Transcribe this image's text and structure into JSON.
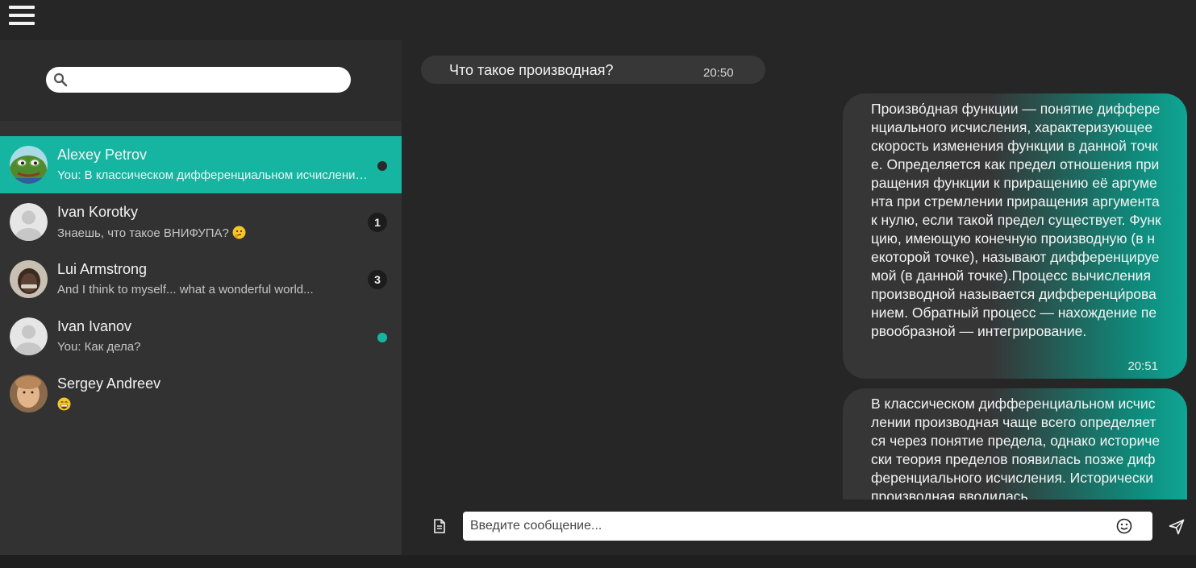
{
  "header": {
    "menu_icon": "hamburger-menu-icon"
  },
  "search": {
    "placeholder": "",
    "value": "",
    "icon": "search-icon"
  },
  "chats": [
    {
      "name": "Alexey Petrov",
      "preview": "You: В классическом дифференциальном исчислении производная чаще всего определяется",
      "indicator": "dot-dark",
      "active": true,
      "avatar": "frog-avatar"
    },
    {
      "name": "Ivan Korotky",
      "preview": "Знаешь, что такое ВНИФУПА?",
      "preview_emoji": "thinking-face-emoji",
      "badge": "1",
      "avatar": "default-user-avatar"
    },
    {
      "name": "Lui Armstrong",
      "preview": "And I think to myself... what a wonderful world...",
      "badge": "3",
      "avatar": "photo-avatar"
    },
    {
      "name": "Ivan Ivanov",
      "preview": "You: Как дела?",
      "indicator": "dot-teal",
      "avatar": "default-user-avatar"
    },
    {
      "name": "Sergey Andreev",
      "preview": "",
      "preview_emoji": "grinning-face-emoji",
      "avatar": "photo-avatar"
    }
  ],
  "messages": [
    {
      "direction": "in",
      "text": "Что такое производная?",
      "time": "20:50"
    },
    {
      "direction": "out",
      "text": "Произво́дная функции — понятие дифференциального исчисления, характеризующее скорость изменения функции в данной точке. Определяется как предел отношения приращения функции к приращению её аргумента при стремлении приращения аргумента к нулю, если такой предел существует. Функцию, имеющую конечную производную (в некоторой точке), называют дифференцируемой (в данной точке).Процесс вычисления производной называется дифференци́рованием. Обратный процесс — нахождение первообразной — интегрирование.",
      "time": "20:51"
    },
    {
      "direction": "out",
      "text": "В классическом дифференциальном исчислении производная чаще всего определяется через понятие предела, однако исторически теория пределов появилась позже дифференциального исчисления. Исторически производная вводилась",
      "time": ""
    }
  ],
  "composer": {
    "placeholder": "Введите сообщение...",
    "attach_icon": "document-icon",
    "emoji_icon": "smiley-icon",
    "send_icon": "send-icon"
  },
  "colors": {
    "accent": "#16b5a2",
    "background": "#262626",
    "sidebar": "#323232",
    "incoming_bubble": "#373737"
  }
}
